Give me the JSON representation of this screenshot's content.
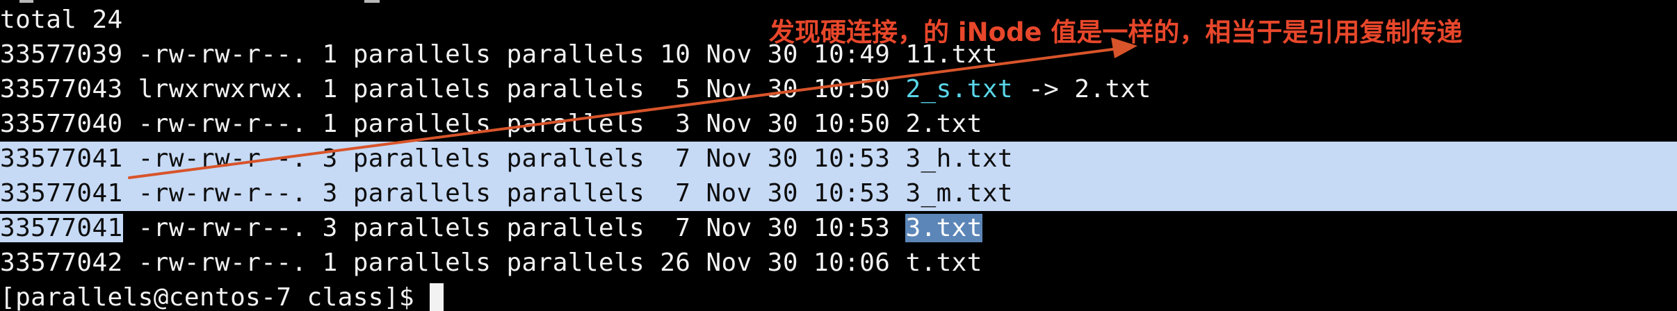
{
  "terminal": {
    "total_line": "total 24",
    "rows": [
      {
        "inode": "33577039",
        "perms": "-rw-rw-r--.",
        "links": "1",
        "owner": "parallels",
        "group": "parallels",
        "size": "10",
        "month": "Nov",
        "day": "30",
        "time": "10:49",
        "name": "11.txt",
        "link_arrow": "",
        "link_target": ""
      },
      {
        "inode": "33577043",
        "perms": "lrwxrwxrwx.",
        "links": "1",
        "owner": "parallels",
        "group": "parallels",
        "size": "5",
        "month": "Nov",
        "day": "30",
        "time": "10:50",
        "name": "2_s.txt",
        "link_arrow": "->",
        "link_target": "2.txt"
      },
      {
        "inode": "33577040",
        "perms": "-rw-rw-r--.",
        "links": "1",
        "owner": "parallels",
        "group": "parallels",
        "size": "3",
        "month": "Nov",
        "day": "30",
        "time": "10:50",
        "name": "2.txt",
        "link_arrow": "",
        "link_target": ""
      },
      {
        "inode": "33577041",
        "perms": "-rw-rw-r--.",
        "links": "3",
        "owner": "parallels",
        "group": "parallels",
        "size": "7",
        "month": "Nov",
        "day": "30",
        "time": "10:53",
        "name": "3_h.txt",
        "link_arrow": "",
        "link_target": ""
      },
      {
        "inode": "33577041",
        "perms": "-rw-rw-r--.",
        "links": "3",
        "owner": "parallels",
        "group": "parallels",
        "size": "7",
        "month": "Nov",
        "day": "30",
        "time": "10:53",
        "name": "3_m.txt",
        "link_arrow": "",
        "link_target": ""
      },
      {
        "inode": "33577041",
        "perms": "-rw-rw-r--.",
        "links": "3",
        "owner": "parallels",
        "group": "parallels",
        "size": "7",
        "month": "Nov",
        "day": "30",
        "time": "10:53",
        "name": "3.txt",
        "link_arrow": "",
        "link_target": ""
      },
      {
        "inode": "33577042",
        "perms": "-rw-rw-r--.",
        "links": "1",
        "owner": "parallels",
        "group": "parallels",
        "size": "26",
        "month": "Nov",
        "day": "30",
        "time": "10:06",
        "name": "t.txt",
        "link_arrow": "",
        "link_target": ""
      }
    ],
    "prompt": "[parallels@centos-7 class]$"
  },
  "annotation": {
    "text": "发现硬连接，的 iNode 值是一样的，相当于是引用复制传递",
    "color": "#e8472b"
  },
  "colors": {
    "background": "#000000",
    "foreground": "#f2f2f2",
    "highlight": "#c6daf6",
    "selection": "#5c86b8",
    "symlink": "#59d6e8"
  }
}
